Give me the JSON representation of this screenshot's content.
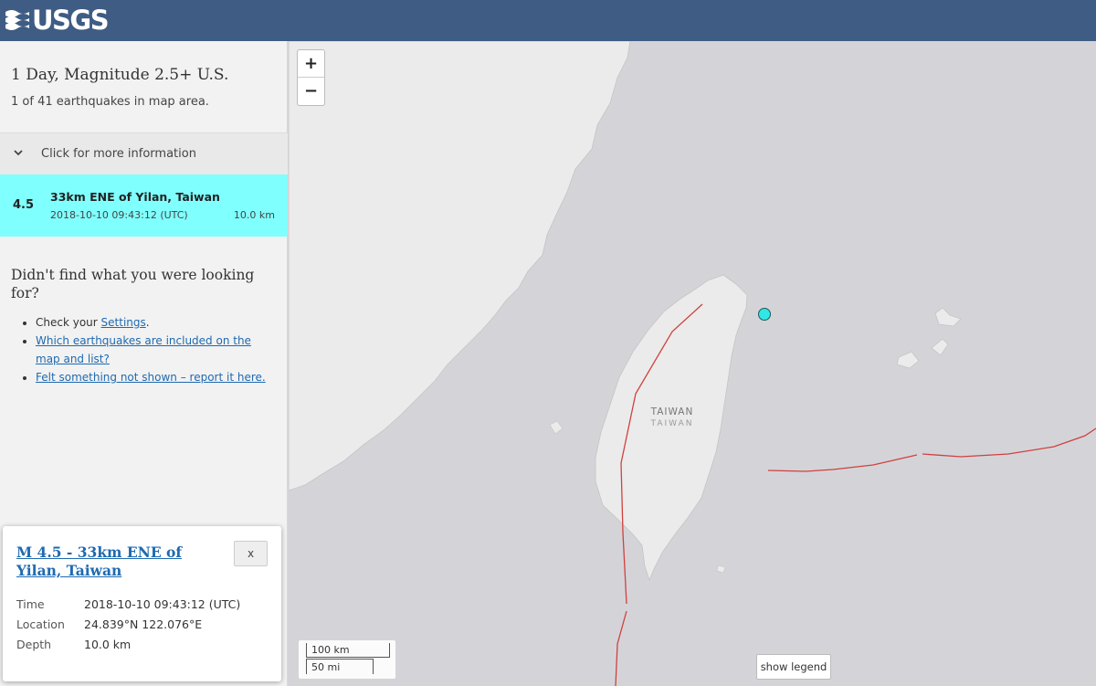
{
  "header": {
    "logo_text": "USGS",
    "logo_icon": "usgs-wave-icon",
    "background": "#3e5c84"
  },
  "sidebar": {
    "title": "1 Day, Magnitude 2.5+ U.S.",
    "count_text": "1 of 41 earthquakes in map area.",
    "more_info_label": "Click for more information",
    "earthquakes": [
      {
        "magnitude": "4.5",
        "place": "33km ENE of Yilan, Taiwan",
        "time": "2018-10-10 09:43:12 (UTC)",
        "depth": "10.0 km",
        "highlight_color": "#80ffff"
      }
    ],
    "help": {
      "title": "Didn't find what you were looking for?",
      "items": [
        {
          "prefix": "Check your ",
          "link": "Settings",
          "suffix": "."
        },
        {
          "prefix": "",
          "link": "Which earthquakes are included on the map and list?",
          "suffix": ""
        },
        {
          "prefix": "",
          "link": "Felt something not shown – report it here.",
          "suffix": ""
        }
      ]
    }
  },
  "popup": {
    "title": "M 4.5 - 33km ENE of Yilan, Taiwan",
    "close_label": "x",
    "rows": [
      {
        "label": "Time",
        "value": "2018-10-10 09:43:12 (UTC)"
      },
      {
        "label": "Location",
        "value": "24.839°N 122.076°E"
      },
      {
        "label": "Depth",
        "value": "10.0 km"
      }
    ]
  },
  "map": {
    "zoom_in_label": "+",
    "zoom_out_label": "−",
    "scale_km": "100 km",
    "scale_mi": "50 mi",
    "legend_button": "show legend",
    "place_label": "TAIWAN",
    "place_label_native": "TAIWAN",
    "colors": {
      "ocean": "#d4d4d8",
      "land": "#ebebeb",
      "plate_boundary": "#d0413e",
      "quake_marker": "#33e6e6"
    }
  }
}
